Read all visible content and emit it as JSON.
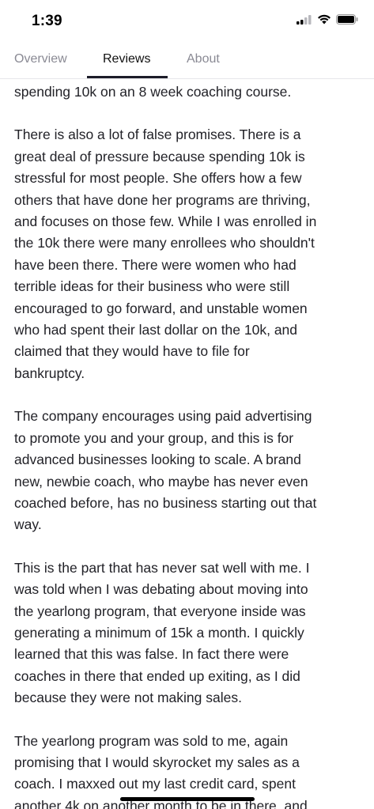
{
  "status": {
    "time": "1:39",
    "icons": [
      "cellular-signal-icon",
      "wifi-icon",
      "battery-icon"
    ]
  },
  "tabs": [
    {
      "label": "Overview",
      "active": false
    },
    {
      "label": "Reviews",
      "active": true
    },
    {
      "label": "About",
      "active": false
    }
  ],
  "review": {
    "paragraphs": [
      "spending 10k on an 8 week coaching course.",
      "There is also a lot of false promises. There is a\ngreat deal of pressure because spending 10k is\nstressful for most people. She offers how a few\nothers that have done her programs are thriving,\nand focuses on those few. While I was enrolled in\nthe 10k there were many enrollees who shouldn't\nhave been there. There were women who had\nterrible ideas for their business who were still\nencouraged to go forward, and unstable women\nwho had spent their last dollar on the 10k, and\nclaimed that they would have to file for\nbankruptcy.",
      "The company encourages using paid advertising\nto promote you and your group, and this is for\nadvanced businesses looking to scale. A brand\nnew, newbie coach, who maybe has never even\ncoached before, has no business starting out that\nway.",
      "This is the part that has never sat well with me. I\nwas told when I was debating about moving into\nthe yearlong program, that everyone inside was\ngenerating a minimum of 15k a month. I quickly\nlearned that this was false. In fact there were\ncoaches in there that ended up exiting, as I did\nbecause they were not making sales.",
      "The yearlong program was sold to me, again\npromising that I would skyrocket my sales as a\ncoach. I maxxed out my last credit card, spent\nanother 4k on another month to be in there, and"
    ]
  },
  "colors": {
    "text": "#222228",
    "tab_inactive": "#8a8a94",
    "tab_active": "#111111",
    "underline": "#1c1c28"
  }
}
